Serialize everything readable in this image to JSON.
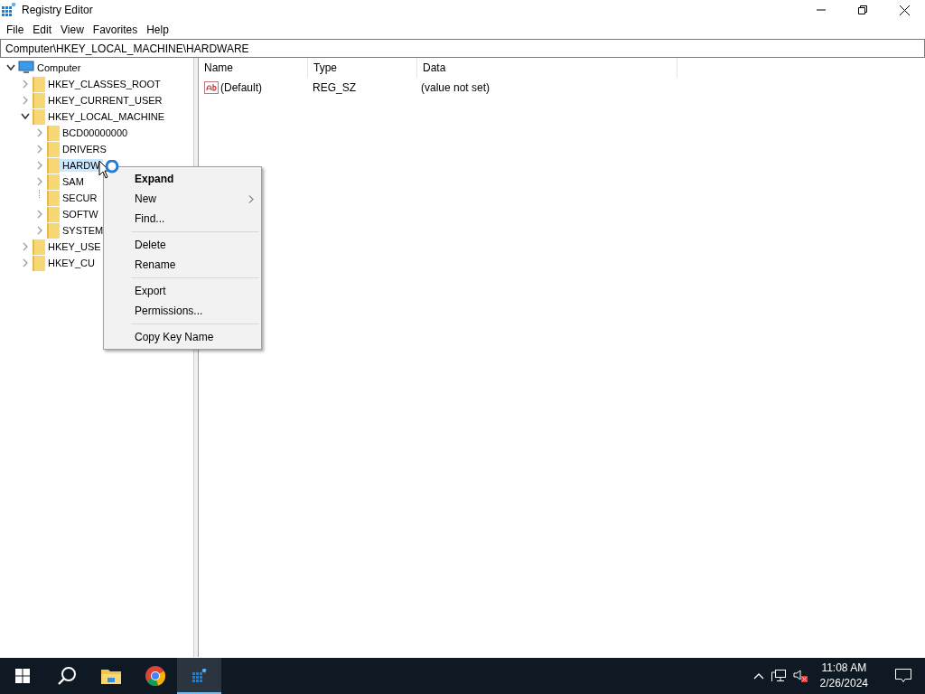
{
  "window": {
    "title": "Registry Editor"
  },
  "menu_bar": [
    "File",
    "Edit",
    "View",
    "Favorites",
    "Help"
  ],
  "address": "Computer\\HKEY_LOCAL_MACHINE\\HARDWARE",
  "tree": [
    {
      "label": "Computer",
      "kind": "computer",
      "expandable": true,
      "expanded": true,
      "selected": false,
      "children": [
        {
          "label": "HKEY_CLASSES_ROOT",
          "kind": "folder",
          "expandable": true,
          "expanded": false,
          "selected": false
        },
        {
          "label": "HKEY_CURRENT_USER",
          "kind": "folder",
          "expandable": true,
          "expanded": false,
          "selected": false
        },
        {
          "label": "HKEY_LOCAL_MACHINE",
          "kind": "folder",
          "expandable": true,
          "expanded": true,
          "selected": false,
          "children": [
            {
              "label": "BCD00000000",
              "kind": "folder",
              "expandable": true,
              "expanded": false,
              "selected": false
            },
            {
              "label": "DRIVERS",
              "kind": "folder",
              "expandable": true,
              "expanded": false,
              "selected": false
            },
            {
              "label": "HARDW",
              "kind": "folder",
              "expandable": true,
              "expanded": false,
              "selected": true
            },
            {
              "label": "SAM",
              "kind": "folder",
              "expandable": true,
              "expanded": false,
              "selected": false
            },
            {
              "label": "SECUR",
              "kind": "folder",
              "expandable": false,
              "selected": false
            },
            {
              "label": "SOFTW",
              "kind": "folder",
              "expandable": true,
              "expanded": false,
              "selected": false
            },
            {
              "label": "SYSTEM",
              "kind": "folder",
              "expandable": true,
              "expanded": false,
              "selected": false
            }
          ]
        },
        {
          "label": "HKEY_USE",
          "kind": "folder",
          "expandable": true,
          "expanded": false,
          "selected": false
        },
        {
          "label": "HKEY_CU",
          "kind": "folder",
          "expandable": true,
          "expanded": false,
          "selected": false
        }
      ]
    }
  ],
  "values": {
    "columns": [
      "Name",
      "Type",
      "Data"
    ],
    "rows": [
      {
        "name": "(Default)",
        "type": "REG_SZ",
        "data": "(value not set)"
      }
    ]
  },
  "context_menu": [
    [
      {
        "label": "Expand",
        "bold": true,
        "submenu": false
      },
      {
        "label": "New",
        "bold": false,
        "submenu": true
      },
      {
        "label": "Find...",
        "bold": false,
        "submenu": false
      }
    ],
    [
      {
        "label": "Delete",
        "bold": false,
        "submenu": false
      },
      {
        "label": "Rename",
        "bold": false,
        "submenu": false
      }
    ],
    [
      {
        "label": "Export",
        "bold": false,
        "submenu": false
      },
      {
        "label": "Permissions...",
        "bold": false,
        "submenu": false
      }
    ],
    [
      {
        "label": "Copy Key Name",
        "bold": false,
        "submenu": false
      }
    ]
  ],
  "taskbar": {
    "apps": [
      {
        "kind": "start",
        "selected": false
      },
      {
        "kind": "search",
        "selected": false
      },
      {
        "kind": "folder",
        "selected": false
      },
      {
        "kind": "browser",
        "selected": false
      },
      {
        "kind": "registry",
        "selected": true
      }
    ],
    "time": "11:08 AM",
    "date": "2/26/2024"
  }
}
